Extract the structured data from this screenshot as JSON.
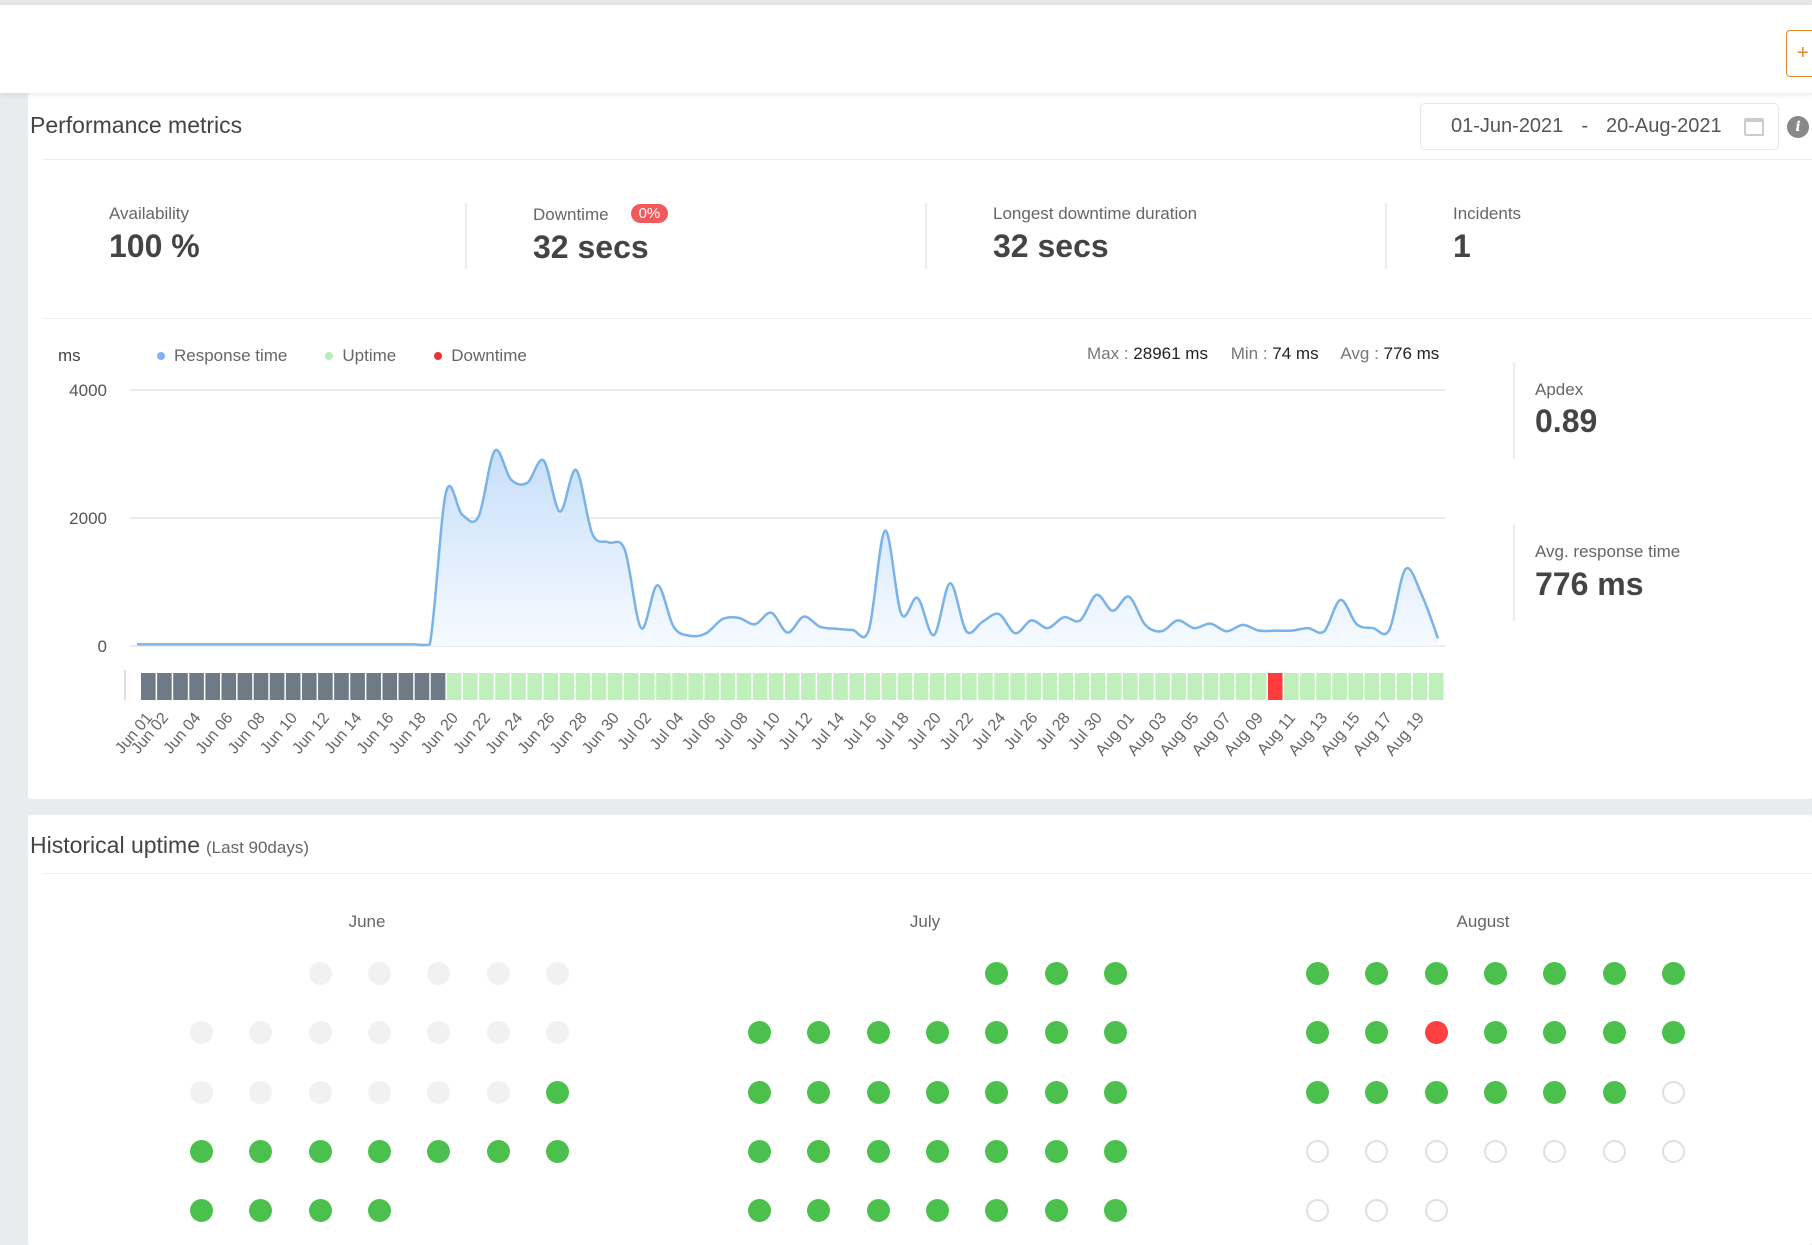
{
  "topbar": {
    "action_label": "+"
  },
  "performance": {
    "title": "Performance metrics",
    "date_from": "01-Jun-2021",
    "date_sep": "-",
    "date_to": "20-Aug-2021",
    "stats": [
      {
        "label": "Availability",
        "value": "100 %"
      },
      {
        "label": "Downtime",
        "value": "32 secs",
        "badge": "0%"
      },
      {
        "label": "Longest downtime duration",
        "value": "32 secs"
      },
      {
        "label": "Incidents",
        "value": "1"
      }
    ],
    "side": {
      "apdex_label": "Apdex",
      "apdex_value": "0.89",
      "avg_label": "Avg. response time",
      "avg_value": "776 ms"
    },
    "summary": {
      "max_label": "Max :",
      "max_value": "28961 ms",
      "min_label": "Min :",
      "min_value": "74 ms",
      "avg_label": "Avg :",
      "avg_value": "776 ms"
    }
  },
  "colors": {
    "line": "#7ab3e8",
    "up": "#bff0bb",
    "down": "#ff3b3b",
    "nodata": "#6e7a86",
    "legend_response": "#7fb4f5",
    "legend_uptime": "#b9ecb9",
    "legend_downtime": "#f03030"
  },
  "chart_data": {
    "type": "area",
    "title": "",
    "xlabel": "",
    "ylabel": "ms",
    "ylim": [
      0,
      4000
    ],
    "yticks": [
      0,
      2000,
      4000
    ],
    "grid": true,
    "legend": [
      {
        "name": "Response time",
        "key": "legend_response"
      },
      {
        "name": "Uptime",
        "key": "legend_uptime"
      },
      {
        "name": "Downtime",
        "key": "legend_downtime"
      }
    ],
    "legend_position": "top-left",
    "x": [
      "Jun 01",
      "Jun 02",
      "Jun 03",
      "Jun 04",
      "Jun 05",
      "Jun 06",
      "Jun 07",
      "Jun 08",
      "Jun 09",
      "Jun 10",
      "Jun 11",
      "Jun 12",
      "Jun 13",
      "Jun 14",
      "Jun 15",
      "Jun 16",
      "Jun 17",
      "Jun 18",
      "Jun 19",
      "Jun 20",
      "Jun 21",
      "Jun 22",
      "Jun 23",
      "Jun 24",
      "Jun 25",
      "Jun 26",
      "Jun 27",
      "Jun 28",
      "Jun 29",
      "Jun 30",
      "Jul 01",
      "Jul 02",
      "Jul 03",
      "Jul 04",
      "Jul 05",
      "Jul 06",
      "Jul 07",
      "Jul 08",
      "Jul 09",
      "Jul 10",
      "Jul 11",
      "Jul 12",
      "Jul 13",
      "Jul 14",
      "Jul 15",
      "Jul 16",
      "Jul 17",
      "Jul 18",
      "Jul 19",
      "Jul 20",
      "Jul 21",
      "Jul 22",
      "Jul 23",
      "Jul 24",
      "Jul 25",
      "Jul 26",
      "Jul 27",
      "Jul 28",
      "Jul 29",
      "Jul 30",
      "Jul 31",
      "Aug 01",
      "Aug 02",
      "Aug 03",
      "Aug 04",
      "Aug 05",
      "Aug 06",
      "Aug 07",
      "Aug 08",
      "Aug 09",
      "Aug 10",
      "Aug 11",
      "Aug 12",
      "Aug 13",
      "Aug 14",
      "Aug 15",
      "Aug 16",
      "Aug 17",
      "Aug 18",
      "Aug 19",
      "Aug 20"
    ],
    "tick_labels": [
      "Jun 01",
      "Jun 02",
      "Jun 04",
      "Jun 06",
      "Jun 08",
      "Jun 10",
      "Jun 12",
      "Jun 14",
      "Jun 16",
      "Jun 18",
      "Jun 20",
      "Jun 22",
      "Jun 24",
      "Jun 26",
      "Jun 28",
      "Jun 30",
      "Jul 02",
      "Jul 04",
      "Jul 06",
      "Jul 08",
      "Jul 10",
      "Jul 12",
      "Jul 14",
      "Jul 16",
      "Jul 18",
      "Jul 20",
      "Jul 22",
      "Jul 24",
      "Jul 26",
      "Jul 28",
      "Jul 30",
      "Aug 01",
      "Aug 03",
      "Aug 05",
      "Aug 07",
      "Aug 09",
      "Aug 11",
      "Aug 13",
      "Aug 15",
      "Aug 17",
      "Aug 19"
    ],
    "series": [
      {
        "name": "Response time",
        "values": [
          25,
          25,
          25,
          25,
          25,
          25,
          25,
          25,
          25,
          25,
          25,
          25,
          25,
          25,
          25,
          25,
          25,
          25,
          25,
          2400,
          2050,
          2020,
          3050,
          2600,
          2550,
          2900,
          2100,
          2750,
          1750,
          1620,
          1500,
          280,
          950,
          300,
          160,
          200,
          420,
          440,
          340,
          520,
          210,
          460,
          300,
          270,
          250,
          250,
          1800,
          500,
          750,
          170,
          980,
          230,
          380,
          500,
          200,
          400,
          280,
          450,
          400,
          800,
          550,
          770,
          330,
          230,
          400,
          280,
          350,
          230,
          330,
          240,
          240,
          240,
          280,
          230,
          720,
          340,
          280,
          250,
          1200,
          800,
          120
        ]
      }
    ],
    "status": [
      "nodata",
      "nodata",
      "nodata",
      "nodata",
      "nodata",
      "nodata",
      "nodata",
      "nodata",
      "nodata",
      "nodata",
      "nodata",
      "nodata",
      "nodata",
      "nodata",
      "nodata",
      "nodata",
      "nodata",
      "nodata",
      "nodata",
      "up",
      "up",
      "up",
      "up",
      "up",
      "up",
      "up",
      "up",
      "up",
      "up",
      "up",
      "up",
      "up",
      "up",
      "up",
      "up",
      "up",
      "up",
      "up",
      "up",
      "up",
      "up",
      "up",
      "up",
      "up",
      "up",
      "up",
      "up",
      "up",
      "up",
      "up",
      "up",
      "up",
      "up",
      "up",
      "up",
      "up",
      "up",
      "up",
      "up",
      "up",
      "up",
      "up",
      "up",
      "up",
      "up",
      "up",
      "up",
      "up",
      "up",
      "up",
      "down",
      "up",
      "up",
      "up",
      "up",
      "up",
      "up",
      "up",
      "up",
      "up",
      "up"
    ]
  },
  "historical": {
    "title": "Historical uptime",
    "subtitle": "(Last 90days)",
    "months": [
      {
        "name": "June",
        "start_weekday": 2,
        "days": [
          "nodata",
          "nodata",
          "nodata",
          "nodata",
          "nodata",
          "nodata",
          "nodata",
          "nodata",
          "nodata",
          "nodata",
          "nodata",
          "nodata",
          "nodata",
          "nodata",
          "nodata",
          "nodata",
          "nodata",
          "nodata",
          "up",
          "up",
          "up",
          "up",
          "up",
          "up",
          "up",
          "up",
          "up",
          "up",
          "up",
          "up"
        ]
      },
      {
        "name": "July",
        "start_weekday": 4,
        "days": [
          "up",
          "up",
          "up",
          "up",
          "up",
          "up",
          "up",
          "up",
          "up",
          "up",
          "up",
          "up",
          "up",
          "up",
          "up",
          "up",
          "up",
          "up",
          "up",
          "up",
          "up",
          "up",
          "up",
          "up",
          "up",
          "up",
          "up",
          "up",
          "up",
          "up",
          "up"
        ]
      },
      {
        "name": "August",
        "start_weekday": 0,
        "days": [
          "up",
          "up",
          "up",
          "up",
          "up",
          "up",
          "up",
          "up",
          "up",
          "down",
          "up",
          "up",
          "up",
          "up",
          "up",
          "up",
          "up",
          "up",
          "up",
          "up",
          "future",
          "future",
          "future",
          "future",
          "future",
          "future",
          "future",
          "future",
          "future",
          "future",
          "future"
        ]
      }
    ]
  }
}
